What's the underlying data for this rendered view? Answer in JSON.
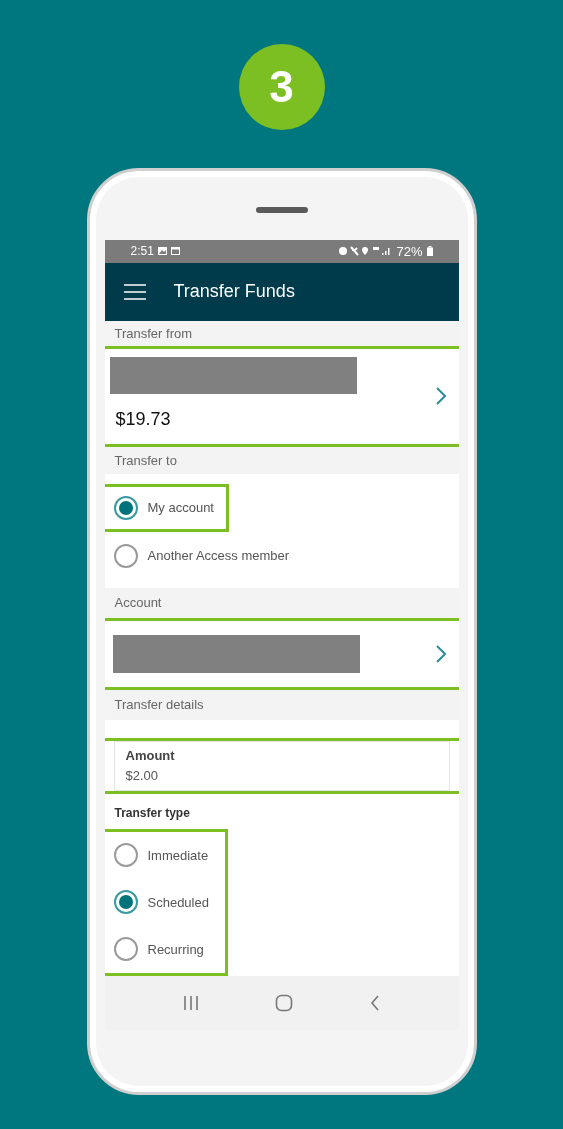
{
  "step_badge": "3",
  "status_bar": {
    "time": "2:51",
    "battery": "72%"
  },
  "app_bar": {
    "title": "Transfer Funds"
  },
  "transfer_from": {
    "header": "Transfer from",
    "balance": "$19.73",
    "highlighted": true
  },
  "transfer_to": {
    "header": "Transfer to",
    "options": [
      {
        "label": "My account",
        "selected": true,
        "highlighted": true
      },
      {
        "label": "Another Access member",
        "selected": false,
        "highlighted": false
      }
    ]
  },
  "account": {
    "header": "Account",
    "highlighted": true
  },
  "transfer_details": {
    "header": "Transfer details",
    "amount": {
      "label": "Amount",
      "value": "$2.00",
      "highlighted": true
    },
    "transfer_type": {
      "label": "Transfer type",
      "highlighted": true,
      "options": [
        {
          "label": "Immediate",
          "selected": false
        },
        {
          "label": "Scheduled",
          "selected": true
        },
        {
          "label": "Recurring",
          "selected": false
        }
      ]
    }
  }
}
